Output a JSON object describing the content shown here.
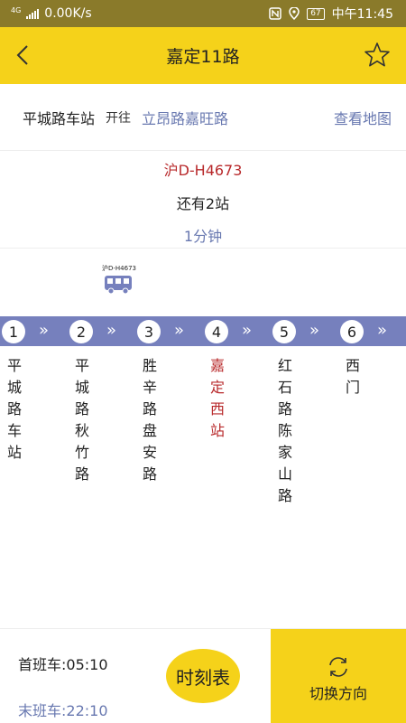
{
  "status_bar": {
    "network_type": "4G",
    "speed": "0.00K/s",
    "battery": "67",
    "time": "中午11:45",
    "icons": [
      "signal-icon",
      "nfc-icon",
      "location-icon",
      "battery-icon"
    ]
  },
  "header": {
    "title": "嘉定11路",
    "back_icon": "chevron-left-icon",
    "favorite_icon": "star-icon"
  },
  "route": {
    "from": "平城路车站",
    "toward_label": "开往",
    "to": "立昂路嘉旺路",
    "map_link": "查看地图"
  },
  "arrival": {
    "plate": "沪D-H4673",
    "stops_away": "还有2站",
    "minutes": "1分钟"
  },
  "bus": {
    "plate": "沪D-H4673",
    "icon": "bus-icon"
  },
  "stations": [
    {
      "number": "1",
      "name": "平城路车站"
    },
    {
      "number": "2",
      "name": "平城路秋竹路"
    },
    {
      "number": "3",
      "name": "胜辛路盘安路"
    },
    {
      "number": "4",
      "name": "嘉定西站"
    },
    {
      "number": "5",
      "name": "红石路陈家山路"
    },
    {
      "number": "6",
      "name": "西门"
    }
  ],
  "current_station": "4",
  "footer": {
    "first_bus": "首班车:05:10",
    "last_bus": "末班车:22:10",
    "timetable_label": "时刻表",
    "switch_label": "切换方向",
    "switch_icon": "refresh-icon"
  },
  "colors": {
    "accent_yellow": "#f5d21a",
    "band_blue": "#7680bd",
    "link_blue": "#6878b0",
    "highlight_red": "#b8292b"
  }
}
